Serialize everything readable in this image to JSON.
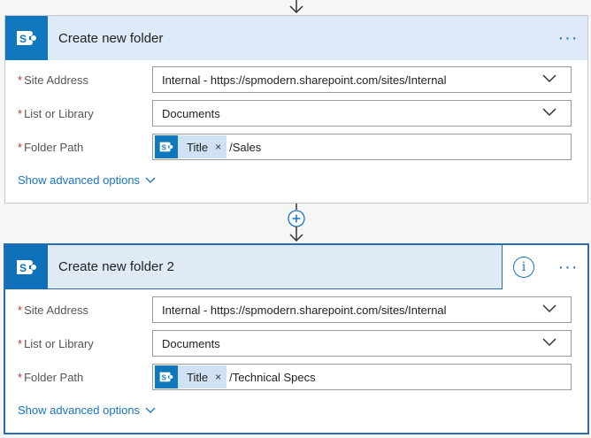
{
  "steps": [
    {
      "title": "Create new folder",
      "fields": {
        "site_address": {
          "label": "Site Address",
          "value": "Internal - https://spmodern.sharepoint.com/sites/Internal"
        },
        "list_or_library": {
          "label": "List or Library",
          "value": "Documents"
        },
        "folder_path": {
          "label": "Folder Path",
          "token": "Title",
          "value": "/Sales"
        }
      },
      "advanced_link": "Show advanced options"
    },
    {
      "title": "Create new folder 2",
      "fields": {
        "site_address": {
          "label": "Site Address",
          "value": "Internal - https://spmodern.sharepoint.com/sites/Internal"
        },
        "list_or_library": {
          "label": "List or Library",
          "value": "Documents"
        },
        "folder_path": {
          "label": "Folder Path",
          "token": "Title",
          "value": "/Technical Specs"
        }
      },
      "advanced_link": "Show advanced options"
    }
  ],
  "required_marker": "*",
  "token_remove": "×",
  "more_label": "···",
  "info_label": "i",
  "icons": {
    "step": "sharepoint-icon",
    "add": "plus-icon",
    "dropdown": "chevron-down-icon"
  },
  "colors": {
    "accent": "#1773c7",
    "header_bg": "#deeaf7",
    "sharepoint_blue": "#0f78bd",
    "required": "#c2372a",
    "selected_border": "#2b6cb0"
  }
}
